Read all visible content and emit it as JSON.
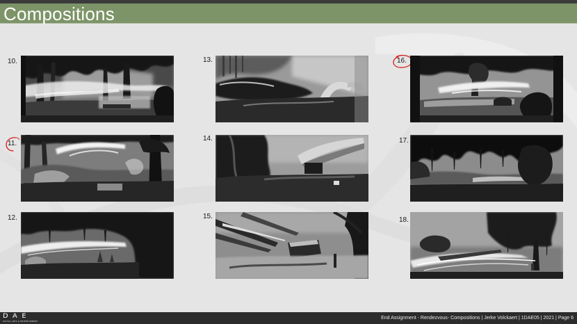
{
  "slide": {
    "title": "Compositions",
    "compositions": [
      {
        "number": "10.",
        "circled": false
      },
      {
        "number": "11.",
        "circled": true
      },
      {
        "number": "12.",
        "circled": false
      },
      {
        "number": "13.",
        "circled": false
      },
      {
        "number": "14.",
        "circled": false
      },
      {
        "number": "15.",
        "circled": false
      },
      {
        "number": "16.",
        "circled": true
      },
      {
        "number": "17.",
        "circled": false
      },
      {
        "number": "18.",
        "circled": false
      }
    ]
  },
  "footer": {
    "logo_text": "DAE",
    "logo_subtitle": "DIGITAL ARTS & ENTERTAINMENT",
    "caption": "End Assignment - Rendezvous- Compositions | Jerke Volckaert | 1DAE05 | 2021 | Page 6"
  },
  "colors": {
    "header": "#7d9468",
    "background": "#e5e5e5",
    "footer": "#2c2c2c",
    "annotation": "#d81e1e"
  }
}
